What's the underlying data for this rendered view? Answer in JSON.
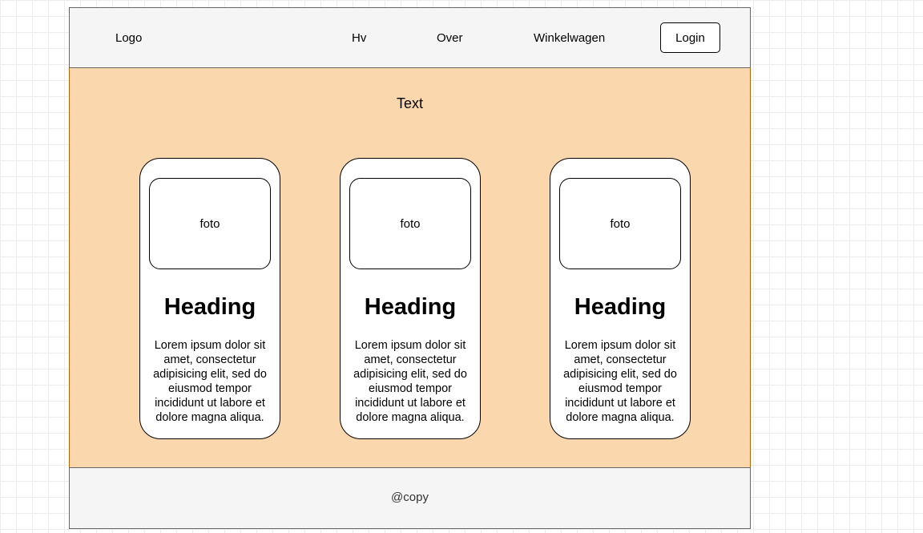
{
  "header": {
    "logo": "Logo",
    "nav": [
      "Hv",
      "Over",
      "Winkelwagen"
    ],
    "login_label": "Login"
  },
  "hero": {
    "title": "Text",
    "background_color": "#fad7ac",
    "cards": [
      {
        "photo_label": "foto",
        "heading": "Heading",
        "body": "Lorem ipsum dolor sit amet, consectetur adipisicing elit, sed do eiusmod tempor incididunt ut labore et dolore magna aliqua."
      },
      {
        "photo_label": "foto",
        "heading": "Heading",
        "body": "Lorem ipsum dolor sit amet, consectetur adipisicing elit, sed do eiusmod tempor incididunt ut labore et dolore magna aliqua."
      },
      {
        "photo_label": "foto",
        "heading": "Heading",
        "body": "Lorem ipsum dolor sit amet, consectetur adipisicing elit, sed do eiusmod tempor incididunt ut labore et dolore magna aliqua."
      }
    ]
  },
  "footer": {
    "copy": "@copy"
  }
}
